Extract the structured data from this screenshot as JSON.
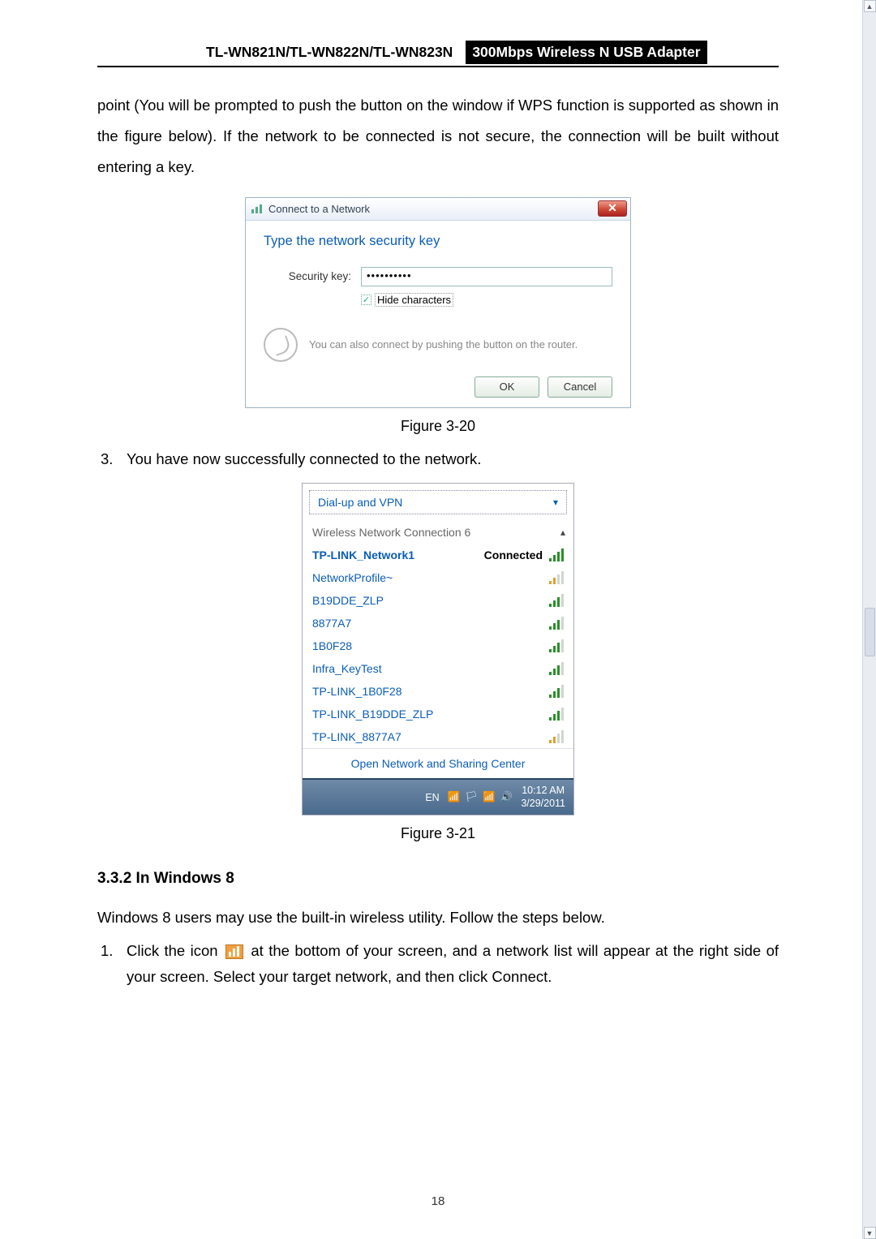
{
  "header": {
    "left": "TL-WN821N/TL-WN822N/TL-WN823N",
    "right": "300Mbps Wireless N USB Adapter"
  },
  "intro_text": "point (You will be prompted to push the button on the window if WPS function is supported as shown in the figure below). If the network to be connected is not secure, the connection will be built without entering a key.",
  "fig320": {
    "title": "Connect to a Network",
    "instruction": "Type the network security key",
    "label": "Security key:",
    "value_masked": "••••••••••",
    "hide_chars": "Hide characters",
    "tip": "You can also connect by pushing the button on the router.",
    "ok": "OK",
    "cancel": "Cancel",
    "caption": "Figure 3-20"
  },
  "step3": {
    "num": "3.",
    "text": "You have now successfully connected to the network."
  },
  "fig321": {
    "dialvpn": "Dial-up and VPN",
    "section": "Wireless Network Connection 6",
    "items": [
      {
        "name": "TP-LINK_Network1",
        "status": "Connected",
        "signal": "full",
        "color": "green",
        "bold": true
      },
      {
        "name": "NetworkProfile~",
        "signal": "weak",
        "color": "yellow"
      },
      {
        "name": "B19DDE_ZLP",
        "signal": "med",
        "color": "green"
      },
      {
        "name": "8877A7",
        "signal": "med",
        "color": "green"
      },
      {
        "name": "1B0F28",
        "signal": "med",
        "color": "green"
      },
      {
        "name": "Infra_KeyTest",
        "signal": "med",
        "color": "green"
      },
      {
        "name": "TP-LINK_1B0F28",
        "signal": "med",
        "color": "green"
      },
      {
        "name": "TP-LINK_B19DDE_ZLP",
        "signal": "med",
        "color": "green"
      },
      {
        "name": "TP-LINK_8877A7",
        "signal": "weak",
        "color": "yellow"
      }
    ],
    "link": "Open Network and Sharing Center",
    "lang": "EN",
    "time": "10:12 AM",
    "date": "3/29/2011",
    "caption": "Figure 3-21"
  },
  "sec332": {
    "heading": "3.3.2  In Windows 8",
    "para": "Windows 8 users may use the built-in wireless utility. Follow the steps below.",
    "step1_num": "1.",
    "step1_a": "Click the icon ",
    "step1_b": " at the bottom of your screen, and a network list will appear at the right side of your screen. Select your target network, and then click Connect."
  },
  "page_number": "18"
}
